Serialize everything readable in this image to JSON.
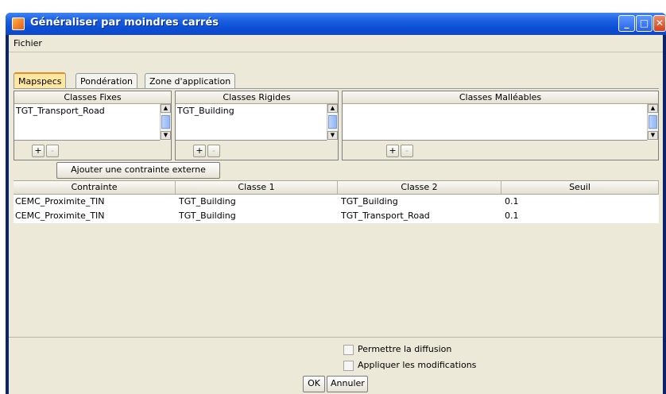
{
  "window": {
    "title": "Généraliser par moindres carrés",
    "buttons": {
      "minimize": "_",
      "maximize": "□",
      "close": "✕"
    }
  },
  "menubar": {
    "items": [
      "Fichier"
    ]
  },
  "tabs": [
    {
      "label": "Mapspecs",
      "active": true
    },
    {
      "label": "Pondération",
      "active": false
    },
    {
      "label": "Zone d'application",
      "active": false
    }
  ],
  "class_panels": {
    "fixes": {
      "header": "Classes Fixes",
      "items": [
        "TGT_Transport_Road"
      ]
    },
    "rigides": {
      "header": "Classes Rigides",
      "items": [
        "TGT_Building"
      ]
    },
    "malleables": {
      "header": "Classes Malléables",
      "items": []
    },
    "add_label": "+",
    "remove_label": "-"
  },
  "external_constraint_button": "Ajouter une contrainte externe",
  "table": {
    "columns": [
      "Contrainte",
      "Classe 1",
      "Classe 2",
      "Seuil"
    ],
    "rows": [
      [
        "CEMC_Proximite_TIN",
        "TGT_Building",
        "TGT_Building",
        "0.1"
      ],
      [
        "CEMC_Proximite_TIN",
        "TGT_Building",
        "TGT_Transport_Road",
        "0.1"
      ]
    ]
  },
  "options": {
    "diffusion": {
      "label": "Permettre la diffusion",
      "checked": false
    },
    "apply": {
      "label": "Appliquer les modifications",
      "checked": false
    }
  },
  "buttons": {
    "ok": "OK",
    "cancel": "Annuler"
  },
  "colors": {
    "titlebar": "#0a4fd6",
    "active_tab": "#ffe7a2",
    "panel_bg": "#ece9d8"
  }
}
